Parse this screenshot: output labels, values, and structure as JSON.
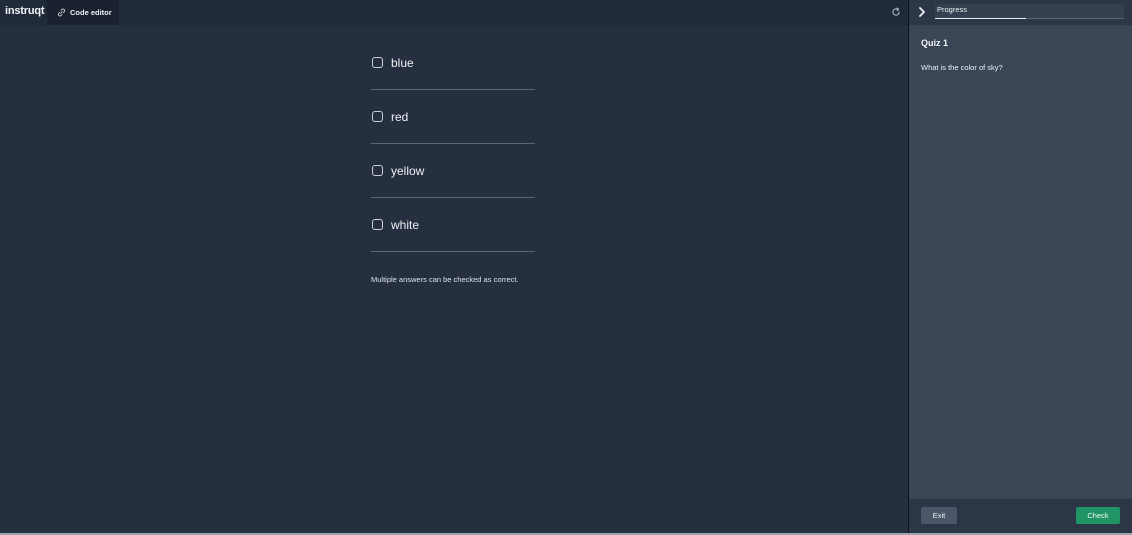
{
  "brand": {
    "logo_text": "instruqt"
  },
  "tabs": [
    {
      "label": "Code editor",
      "icon": "link-icon"
    }
  ],
  "toolbar": {
    "refresh_icon": "refresh-icon"
  },
  "quiz": {
    "options": [
      {
        "label": "blue",
        "checked": false
      },
      {
        "label": "red",
        "checked": false
      },
      {
        "label": "yellow",
        "checked": false
      },
      {
        "label": "white",
        "checked": false
      }
    ],
    "hint": "Multiple answers can be checked as correct."
  },
  "panel": {
    "collapse_icon": "chevron-right-icon",
    "progress": {
      "label": "Progress",
      "fraction": 0.48
    },
    "title": "Quiz 1",
    "question": "What is the color of sky?",
    "footer": {
      "exit_label": "Exit",
      "check_label": "Check"
    }
  },
  "colors": {
    "main_bg": "#252f40",
    "panel_bg": "#3a4556",
    "check_button": "#1f9464",
    "exit_button": "#4b5668"
  }
}
